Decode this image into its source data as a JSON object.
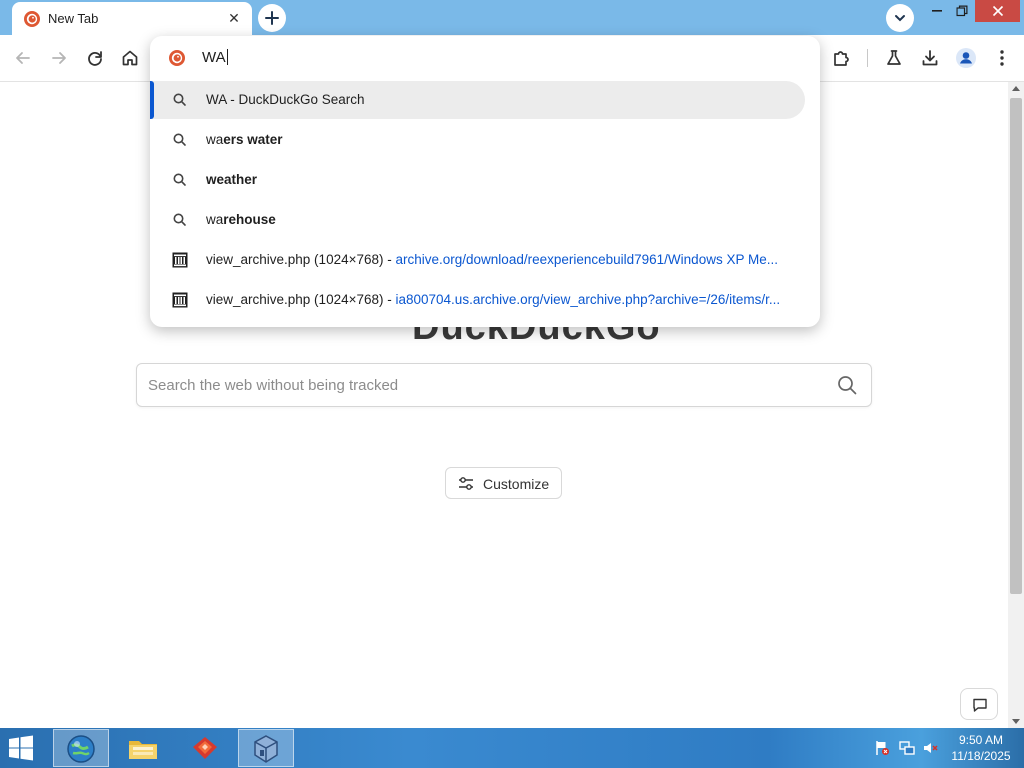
{
  "browser": {
    "tab": {
      "title": "New Tab",
      "close_symbol": "✕"
    },
    "toolbar_icons": [
      "back-icon",
      "forward-icon",
      "reload-icon",
      "home-icon",
      "extensions-icon",
      "labs-icon",
      "download-icon",
      "profile-icon",
      "menu-icon"
    ],
    "omnibox": {
      "typed_text": "WA",
      "suggestions": [
        {
          "type": "search",
          "icon": "search-icon",
          "text": "WA - DuckDuckGo Search",
          "selected": true
        },
        {
          "type": "search",
          "icon": "search-icon",
          "typed": "wa",
          "completion": "ers water"
        },
        {
          "type": "search",
          "icon": "search-icon",
          "typed": "",
          "completion": "weather"
        },
        {
          "type": "search",
          "icon": "search-icon",
          "typed": "wa",
          "completion": "rehouse"
        },
        {
          "type": "history",
          "icon": "archive-icon",
          "title": "view_archive.php (1024×768)",
          "separator": " - ",
          "url": "archive.org/download/reexperiencebuild7961/Windows XP Me..."
        },
        {
          "type": "history",
          "icon": "archive-icon",
          "title": "view_archive.php (1024×768)",
          "separator": " - ",
          "url": "ia800704.us.archive.org/view_archive.php?archive=/26/items/r..."
        }
      ]
    }
  },
  "page": {
    "logo_partial": "DuckDuckGo",
    "search_placeholder": "Search the web without being tracked",
    "customize_label": "Customize"
  },
  "taskbar": {
    "apps": [
      "internet-explorer",
      "file-explorer",
      "firefox",
      "virtualbox"
    ],
    "clock": {
      "time": "9:50 AM",
      "date": "11/18/2025"
    }
  },
  "colors": {
    "titlebar": "#7ab9e8",
    "accent": "#0b57d0",
    "close_button": "#c94a44",
    "ddg_orange": "#de5833"
  }
}
